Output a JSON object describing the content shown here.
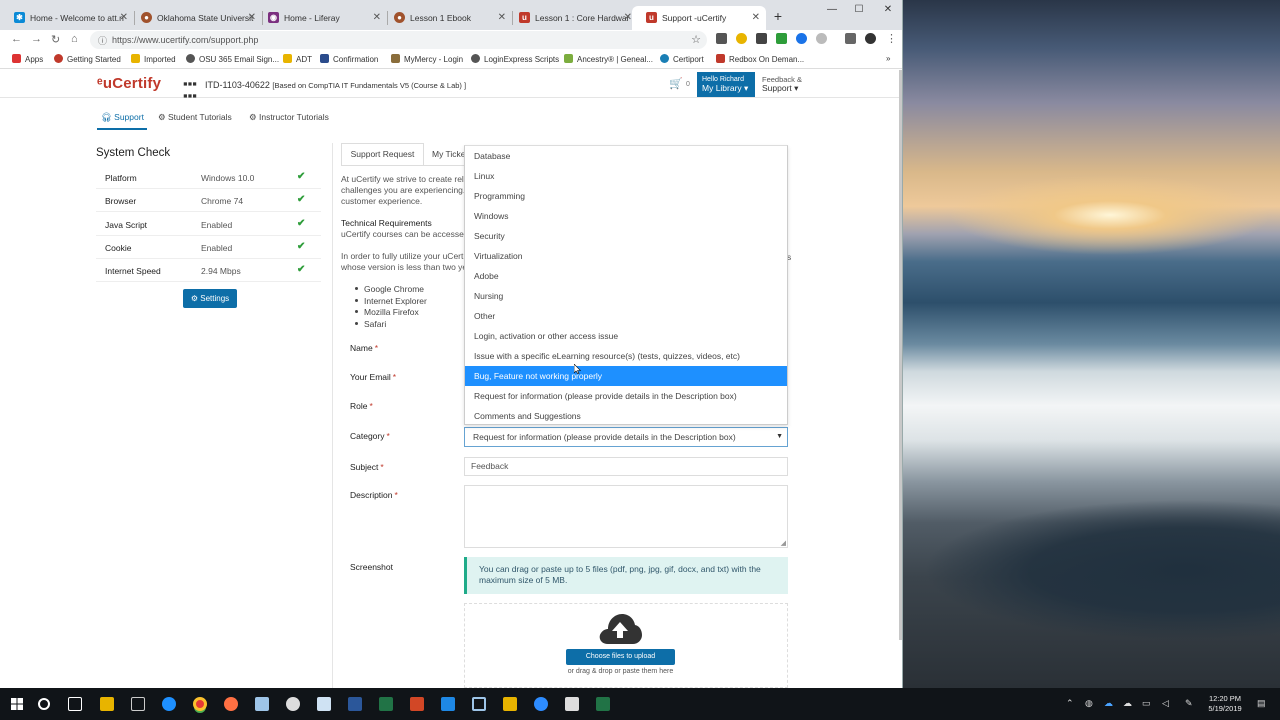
{
  "browser": {
    "tabs": [
      {
        "title": "Home - Welcome to att.n",
        "icon": "att-icon",
        "color": "#0a8ad6"
      },
      {
        "title": "Oklahoma State Universit",
        "icon": "osu-icon",
        "color": "#a0522d"
      },
      {
        "title": "Home - Liferay",
        "icon": "liferay-icon",
        "color": "#7b2f7f"
      },
      {
        "title": "Lesson 1 Ebook",
        "icon": "ebook-icon",
        "color": "#a0522d"
      },
      {
        "title": "Lesson 1 : Core Hardwar",
        "icon": "ucertify-icon",
        "color": "#c0392b"
      },
      {
        "title": "Support -uCertify",
        "icon": "ucertify-icon",
        "color": "#c0392b"
      }
    ],
    "url": "https://www.ucertify.com/support.php",
    "bookmarks": [
      {
        "label": "Apps",
        "color": "#d33"
      },
      {
        "label": "Getting Started",
        "color": "#c0392b"
      },
      {
        "label": "Imported",
        "color": "#e8b400"
      },
      {
        "label": "OSU 365 Email Sign...",
        "color": "#555"
      },
      {
        "label": "ADT",
        "color": "#e8b400"
      },
      {
        "label": "Confirmation",
        "color": "#2b4c8c"
      },
      {
        "label": "MyMercy - Login",
        "color": "#8a6d3b"
      },
      {
        "label": "LoginExpress Scripts",
        "color": "#555"
      },
      {
        "label": "Ancestry® | Geneal...",
        "color": "#7cad3e"
      },
      {
        "label": "Certiport",
        "color": "#1a7fb5"
      },
      {
        "label": "Redbox On Deman...",
        "color": "#c0392b"
      }
    ],
    "more_bookmarks": "»"
  },
  "header": {
    "logo": "uCertify",
    "course_code": "ITD-1103-40622",
    "course_desc": "[Based on CompTIA IT Fundamentals V5 (Course & Lab) ]",
    "cart_count": "0",
    "greeting": "Hello Richard",
    "library": "My Library ▾",
    "feedback": "Feedback &",
    "support": "Support ▾"
  },
  "subnav": {
    "support": "Support",
    "student": "Student Tutorials",
    "instructor": "Instructor Tutorials"
  },
  "system_check": {
    "title": "System Check",
    "rows": [
      {
        "key": "Platform",
        "value": "Windows 10.0"
      },
      {
        "key": "Browser",
        "value": "Chrome 74"
      },
      {
        "key": "Java Script",
        "value": "Enabled"
      },
      {
        "key": "Cookie",
        "value": "Enabled"
      },
      {
        "key": "Internet Speed",
        "value": "2.94 Mbps"
      }
    ],
    "check": "✔",
    "settings_label": "Settings"
  },
  "content": {
    "tab_support": "Support Request",
    "tab_tickets": "My Ticke",
    "intro": [
      "At uCertify we strive to create relia",
      "challenges you are experiencing. W",
      "customer experience."
    ],
    "techreq_title": "Technical Requirements",
    "techreq_line": "uCertify courses can be accessed",
    "browser_req": [
      "In order to fully utilize your uCert",
      "whose version is less than two ye"
    ],
    "side_char": "s",
    "browsers": [
      "Google Chrome",
      "Internet Explorer",
      "Mozilla Firefox",
      "Safari"
    ]
  },
  "form": {
    "name_label": "Name",
    "email_label": "Your Email",
    "role_label": "Role",
    "category_label": "Category",
    "subject_label": "Subject",
    "description_label": "Description",
    "screenshot_label": "Screenshot",
    "required": "*",
    "category_value": "Request for information (please provide details in the Description box)",
    "subject_value": "Feedback",
    "upload_note": "You can drag or paste up to 5 files (pdf, png, jpg, gif, docx, and txt) with the maximum size of 5 MB.",
    "choose_files": "Choose files to upload",
    "drag_hint": "or drag & drop or paste them here"
  },
  "dropdown": {
    "options": [
      "Database",
      "Linux",
      "Programming",
      "Windows",
      "Security",
      "Virtualization",
      "Adobe",
      "Nursing",
      "Other",
      "Login, activation or other access issue",
      "Issue with a specific eLearning resource(s) (tests, quizzes, videos, etc)",
      "Bug, Feature not working properly",
      "Request for information (please provide details in the Description box)",
      "Comments and Suggestions"
    ],
    "highlighted": "Bug, Feature not working properly"
  },
  "taskbar": {
    "time": "12:20 PM",
    "date": "5/19/2019"
  }
}
